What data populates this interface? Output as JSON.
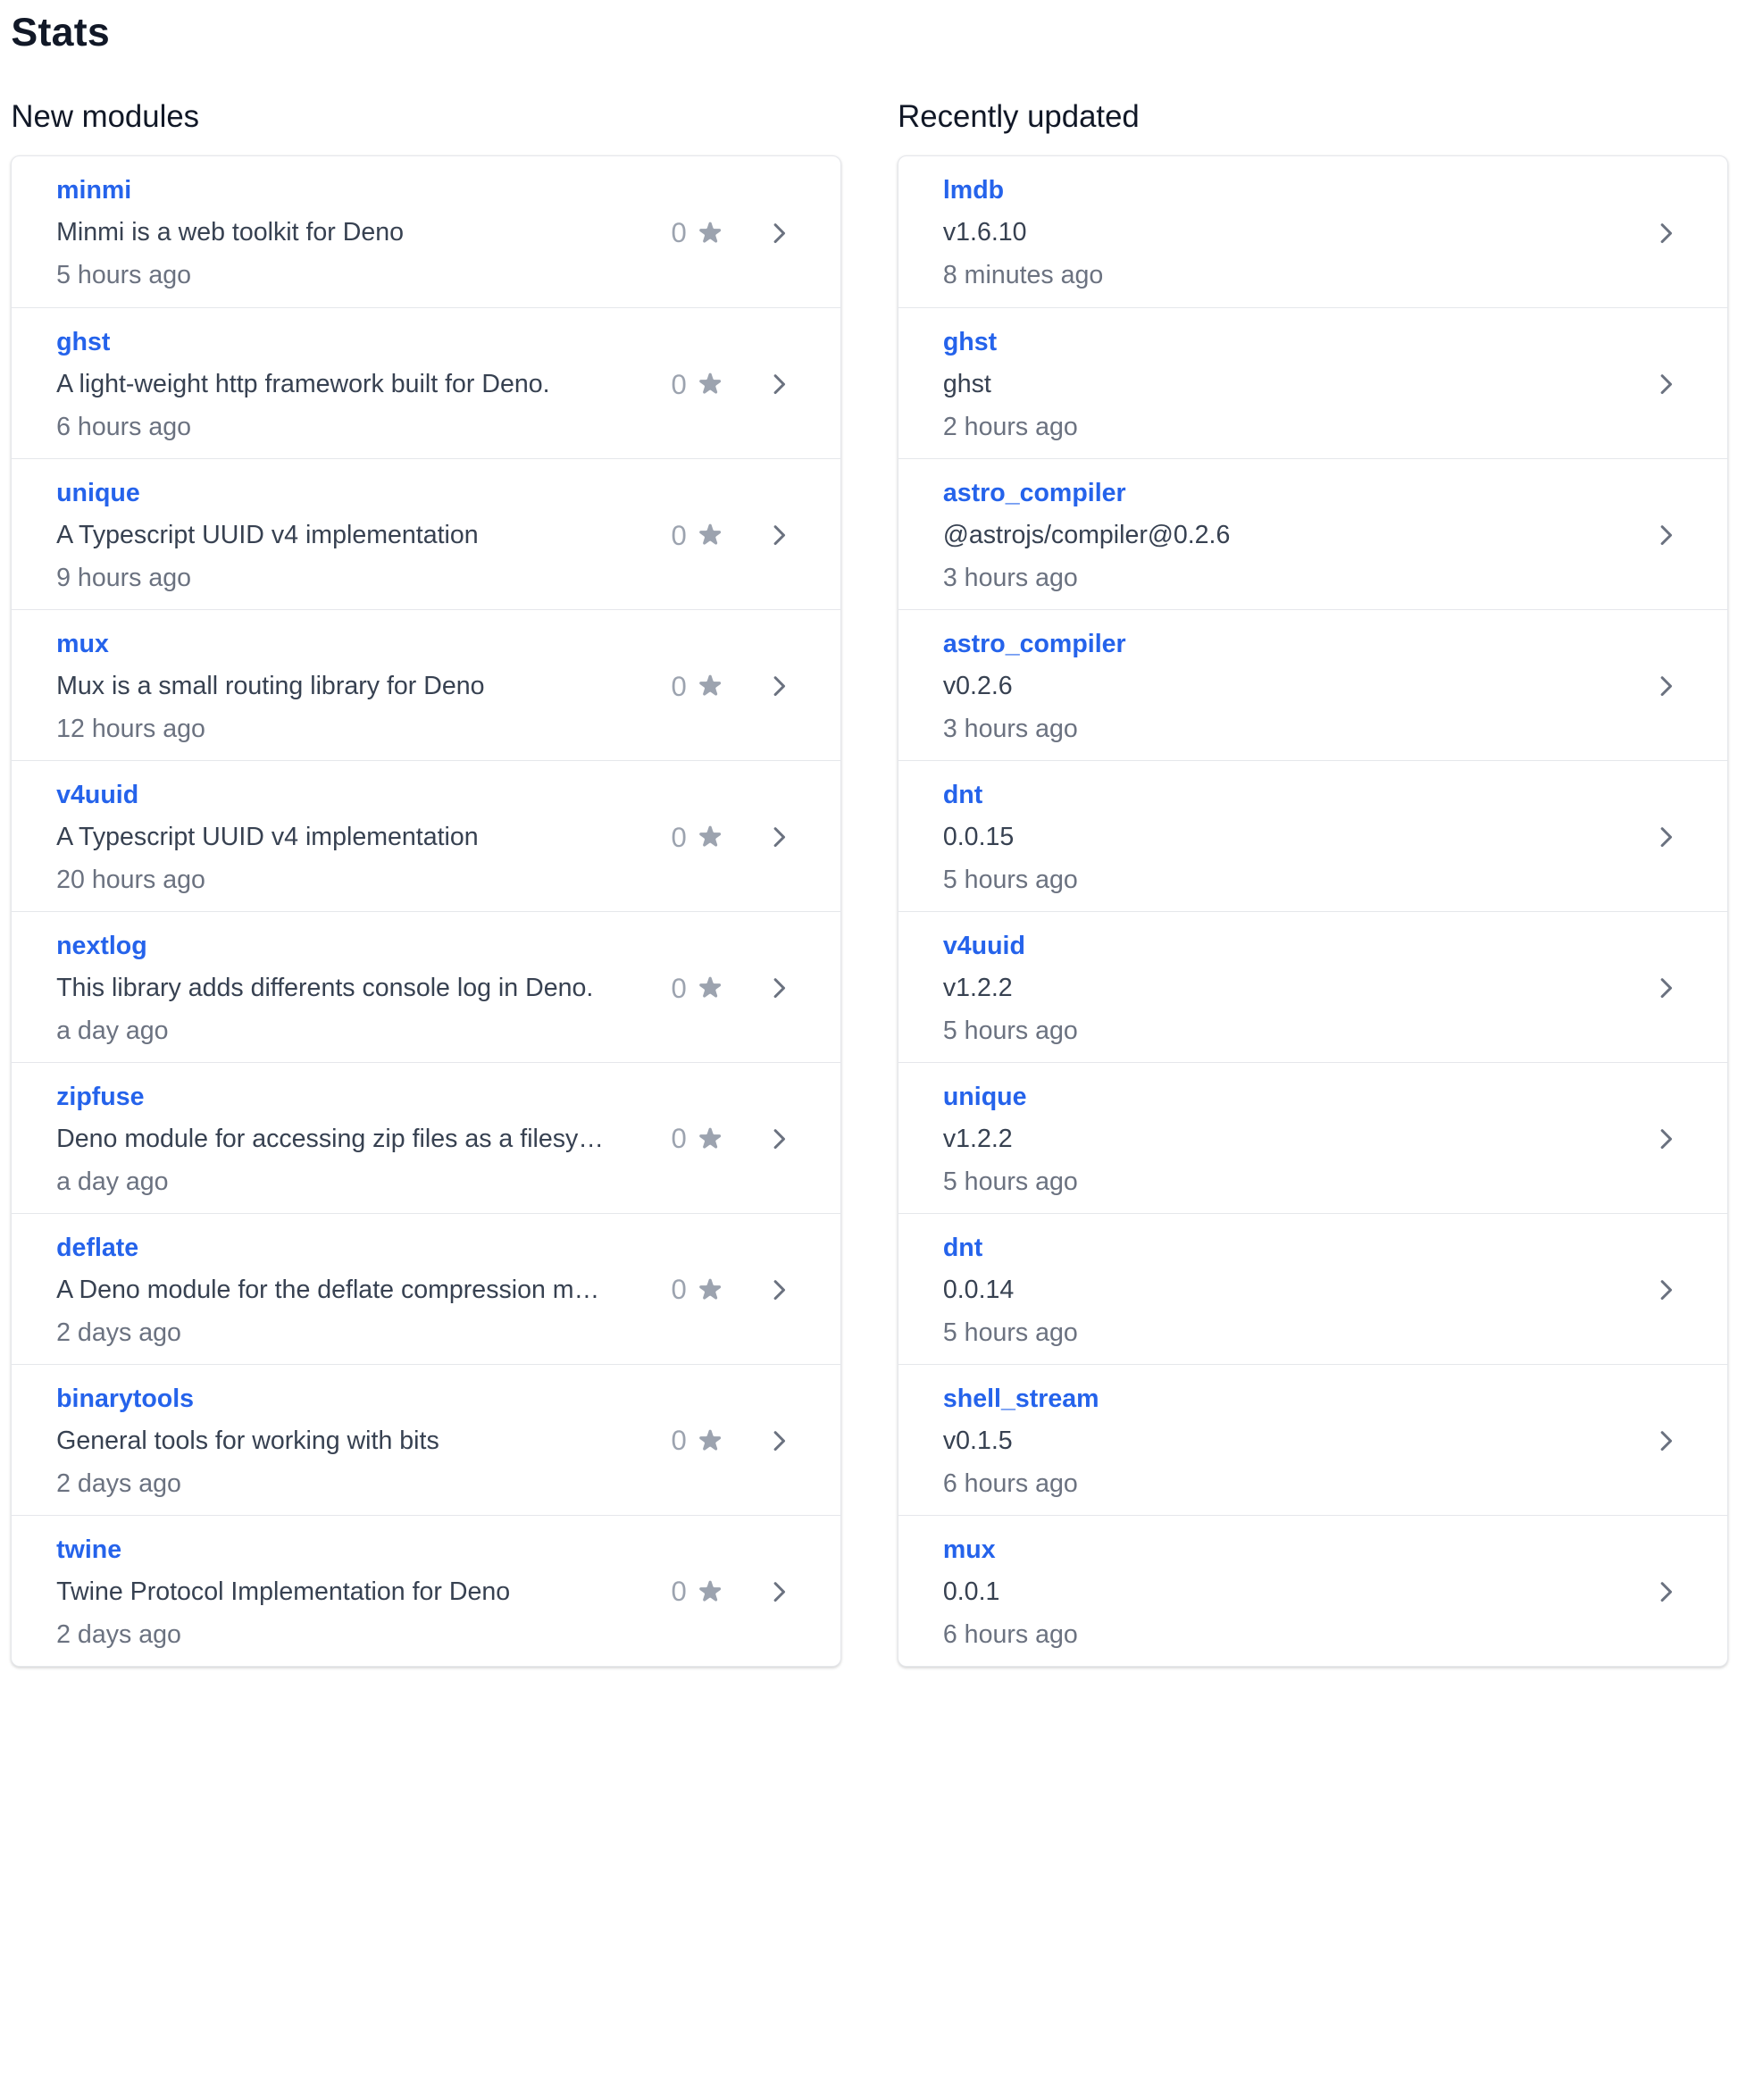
{
  "page": {
    "title": "Stats"
  },
  "new_modules": {
    "heading": "New modules",
    "items": [
      {
        "name": "minmi",
        "description": "Minmi is a web toolkit for Deno",
        "stars": "0",
        "time": "5 hours ago"
      },
      {
        "name": "ghst",
        "description": "A light-weight http framework built for Deno.",
        "stars": "0",
        "time": "6 hours ago"
      },
      {
        "name": "unique",
        "description": "A Typescript UUID v4 implementation",
        "stars": "0",
        "time": "9 hours ago"
      },
      {
        "name": "mux",
        "description": "Mux is a small routing library for Deno",
        "stars": "0",
        "time": "12 hours ago"
      },
      {
        "name": "v4uuid",
        "description": "A Typescript UUID v4 implementation",
        "stars": "0",
        "time": "20 hours ago"
      },
      {
        "name": "nextlog",
        "description": "This library adds differents console log in Deno.",
        "stars": "0",
        "time": "a day ago"
      },
      {
        "name": "zipfuse",
        "description": "Deno module for accessing zip files as a filesy…",
        "stars": "0",
        "time": "a day ago"
      },
      {
        "name": "deflate",
        "description": "A Deno module for the deflate compression m…",
        "stars": "0",
        "time": "2 days ago"
      },
      {
        "name": "binarytools",
        "description": "General tools for working with bits",
        "stars": "0",
        "time": "2 days ago"
      },
      {
        "name": "twine",
        "description": "Twine Protocol Implementation for Deno",
        "stars": "0",
        "time": "2 days ago"
      }
    ]
  },
  "recently_updated": {
    "heading": "Recently updated",
    "items": [
      {
        "name": "lmdb",
        "version": "v1.6.10",
        "time": "8 minutes ago"
      },
      {
        "name": "ghst",
        "version": "ghst",
        "time": "2 hours ago"
      },
      {
        "name": "astro_compiler",
        "version": "@astrojs/compiler@0.2.6",
        "time": "3 hours ago"
      },
      {
        "name": "astro_compiler",
        "version": "v0.2.6",
        "time": "3 hours ago"
      },
      {
        "name": "dnt",
        "version": "0.0.15",
        "time": "5 hours ago"
      },
      {
        "name": "v4uuid",
        "version": "v1.2.2",
        "time": "5 hours ago"
      },
      {
        "name": "unique",
        "version": "v1.2.2",
        "time": "5 hours ago"
      },
      {
        "name": "dnt",
        "version": "0.0.14",
        "time": "5 hours ago"
      },
      {
        "name": "shell_stream",
        "version": "v0.1.5",
        "time": "6 hours ago"
      },
      {
        "name": "mux",
        "version": "0.0.1",
        "time": "6 hours ago"
      }
    ]
  },
  "icons": {
    "star": "star-icon",
    "chevron": "chevron-right-icon"
  },
  "colors": {
    "link": "#2563eb",
    "muted": "#6b7280",
    "star": "#9ca3af"
  }
}
